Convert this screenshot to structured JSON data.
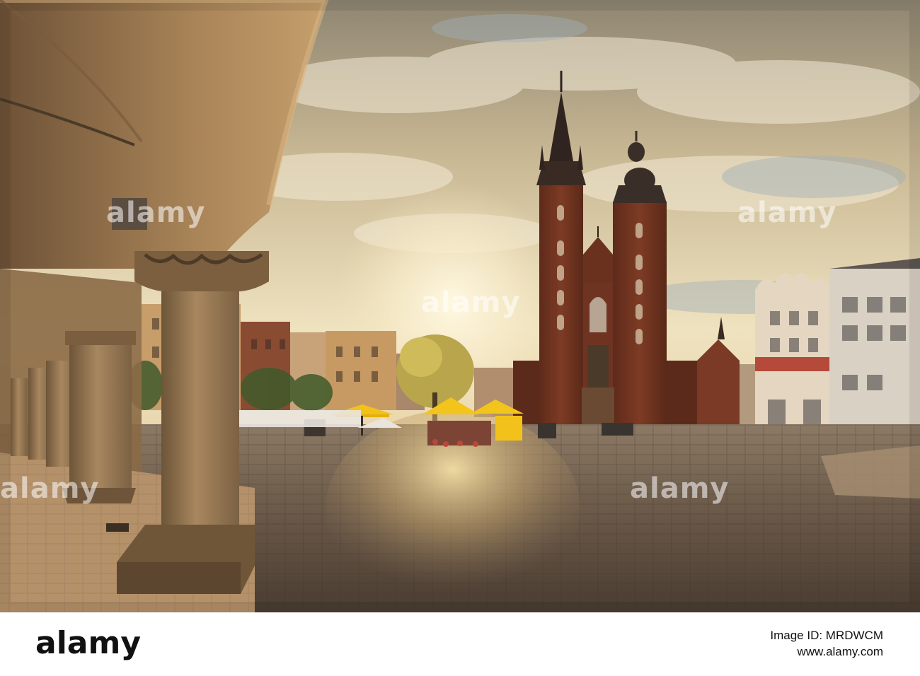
{
  "watermark": {
    "text": "alamy"
  },
  "footer": {
    "logo": "alamy",
    "image_id_label": "Image ID: MRDWCM",
    "url": "www.alamy.com"
  },
  "colors": {
    "sky_top": "#c9b590",
    "sky_glow": "#f6ecd0",
    "brick": "#7a3a24",
    "arcade_stone": "#a07c56",
    "cobble_wet": "#6d5a48",
    "umbrella": "#f2c21a"
  }
}
